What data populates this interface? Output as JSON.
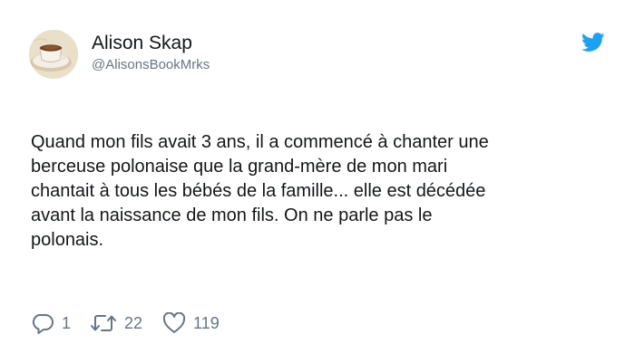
{
  "tweet": {
    "author": {
      "display_name": "Alison Skap",
      "handle": "@AlisonsBookMrks",
      "avatar_icon": "coffee-cup-avatar"
    },
    "brand_icon": "twitter-bird-icon",
    "text": "Quand mon fils avait 3 ans, il a commencé à chanter une\nberceuse polonaise que la grand-mère de mon mari\nchantait à tous les bébés de la famille... elle est décédée\navant la naissance de mon fils. On ne parle pas le\npolonais.",
    "actions": {
      "reply_count": "1",
      "retweet_count": "22",
      "like_count": "119"
    },
    "colors": {
      "brand": "#1da1f2",
      "text": "#14171a",
      "secondary": "#657786"
    }
  }
}
